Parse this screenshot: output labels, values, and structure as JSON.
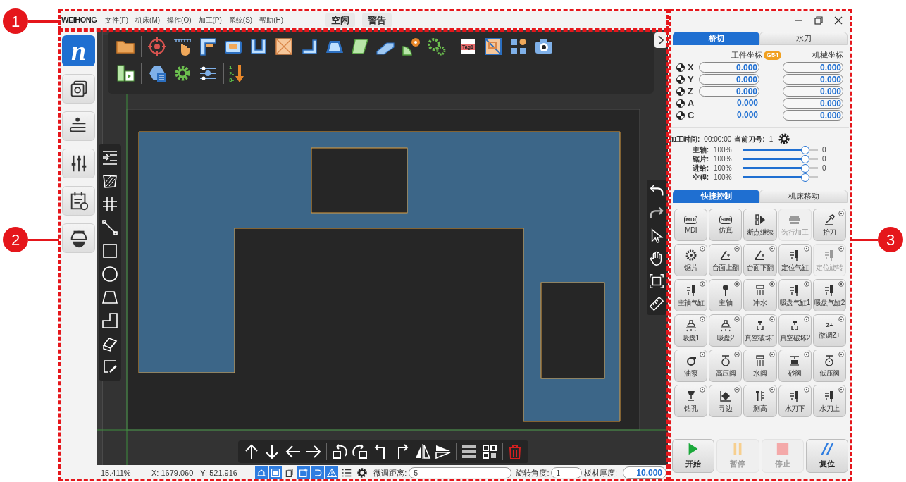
{
  "callouts": [
    {
      "label": "1"
    },
    {
      "label": "2"
    },
    {
      "label": "3"
    }
  ],
  "menu_bar": {
    "logo": "WEIHONG",
    "items": [
      "文件(F)",
      "机床(M)",
      "操作(O)",
      "加工(P)",
      "系统(S)",
      "帮助(H)"
    ],
    "status_badges": [
      "空闲",
      "警告"
    ]
  },
  "sidebar": {
    "logo": "n"
  },
  "toolbar": {
    "tag_label": "Tag1",
    "sequence_numbers": [
      "1-",
      "2-",
      "3-"
    ]
  },
  "status_bar": {
    "zoom": "15.411%",
    "x": "X: 1679.060",
    "y": "Y: 521.916",
    "view_toggles": [
      {
        "on": true
      },
      {
        "on": true
      },
      {
        "on": false
      },
      {
        "on": true
      },
      {
        "on": true
      },
      {
        "on": true
      }
    ],
    "fields": [
      {
        "label": "微调距离:",
        "value": "5"
      },
      {
        "label": "旋转角度:",
        "value": "1"
      }
    ],
    "thickness": {
      "label": "板材厚度:",
      "value": "10.000"
    }
  },
  "right_panel": {
    "mode_tabs": [
      {
        "label": "桥切",
        "selected": true
      },
      {
        "label": "水刀",
        "selected": false
      }
    ],
    "work_header": "工件坐标",
    "coord_badge": "G54",
    "machine_header": "机械坐标",
    "axes": [
      {
        "name": "X",
        "work": "0.000",
        "work_editable": true,
        "machine": "0.000"
      },
      {
        "name": "Y",
        "work": "0.000",
        "work_editable": true,
        "machine": "0.000"
      },
      {
        "name": "Z",
        "work": "0.000",
        "work_editable": true,
        "machine": "0.000"
      },
      {
        "name": "A",
        "work": "0.000",
        "work_editable": false,
        "machine": "0.000"
      },
      {
        "name": "C",
        "work": "0.000",
        "work_editable": false,
        "machine": "0.000"
      }
    ],
    "time_label": "加工时间:",
    "time": "00:00:00",
    "tool_label": "当前刀号:",
    "tool": "1",
    "overrides": [
      {
        "label": "主轴:",
        "percent": "100%",
        "level": 0.83,
        "reading": "0"
      },
      {
        "label": "锯片:",
        "percent": "100%",
        "level": 0.83,
        "reading": "0"
      },
      {
        "label": "进给:",
        "percent": "100%",
        "level": 0.83,
        "reading": "0"
      },
      {
        "label": "空程:",
        "percent": "100%",
        "level": 0.83
      }
    ],
    "control_tabs": [
      {
        "label": "快捷控制",
        "selected": true
      },
      {
        "label": "机床移动",
        "selected": false
      }
    ],
    "quick_buttons": [
      {
        "label": "MDI",
        "icon_text": "MDI",
        "disabled": false,
        "has_options": false
      },
      {
        "label": "仿真",
        "icon_text": "SIM",
        "disabled": false,
        "has_options": false
      },
      {
        "label": "断点继续",
        "disabled": false,
        "has_options": false
      },
      {
        "label": "选行加工",
        "disabled": true,
        "has_options": false
      },
      {
        "label": "抬刀",
        "disabled": false,
        "has_options": true
      },
      {
        "label": "锯片",
        "disabled": false,
        "has_options": true
      },
      {
        "label": "台面上翻",
        "disabled": false,
        "has_options": true
      },
      {
        "label": "台面下翻",
        "disabled": false,
        "has_options": true
      },
      {
        "label": "定位气缸",
        "disabled": false,
        "has_options": true
      },
      {
        "label": "定位旋转",
        "disabled": true,
        "has_options": true
      },
      {
        "label": "主轴气缸",
        "disabled": false,
        "has_options": true
      },
      {
        "label": "主轴",
        "disabled": false,
        "has_options": true
      },
      {
        "label": "冲水",
        "disabled": false,
        "has_options": true
      },
      {
        "label": "吸盘气缸1",
        "disabled": false,
        "has_options": true
      },
      {
        "label": "吸盘气缸2",
        "disabled": false,
        "has_options": true
      },
      {
        "label": "吸盘1",
        "disabled": false,
        "has_options": true
      },
      {
        "label": "吸盘2",
        "disabled": false,
        "has_options": true
      },
      {
        "label": "真空破坏1",
        "disabled": false,
        "has_options": true
      },
      {
        "label": "真空破坏2",
        "disabled": false,
        "has_options": true
      },
      {
        "label": "微调Z+",
        "icon_text": "Z+",
        "disabled": false,
        "has_options": true
      },
      {
        "label": "油泵",
        "disabled": false,
        "has_options": true
      },
      {
        "label": "高压阀",
        "disabled": false,
        "has_options": true
      },
      {
        "label": "水阀",
        "disabled": false,
        "has_options": true
      },
      {
        "label": "砂阀",
        "disabled": false,
        "has_options": true
      },
      {
        "label": "低压阀",
        "disabled": false,
        "has_options": true
      },
      {
        "label": "钻孔",
        "disabled": false,
        "has_options": true
      },
      {
        "label": "寻边",
        "disabled": false,
        "has_options": true
      },
      {
        "label": "测高",
        "disabled": false,
        "has_options": true
      },
      {
        "label": "水刀下",
        "disabled": false,
        "has_options": true
      },
      {
        "label": "水刀上",
        "disabled": false,
        "has_options": true
      }
    ],
    "run_buttons": [
      {
        "kind": "start",
        "label": "开始",
        "disabled": false
      },
      {
        "kind": "pause",
        "label": "暂停",
        "disabled": true
      },
      {
        "kind": "stop",
        "label": "停止",
        "disabled": true
      },
      {
        "kind": "reset",
        "label": "复位",
        "disabled": false
      }
    ]
  }
}
